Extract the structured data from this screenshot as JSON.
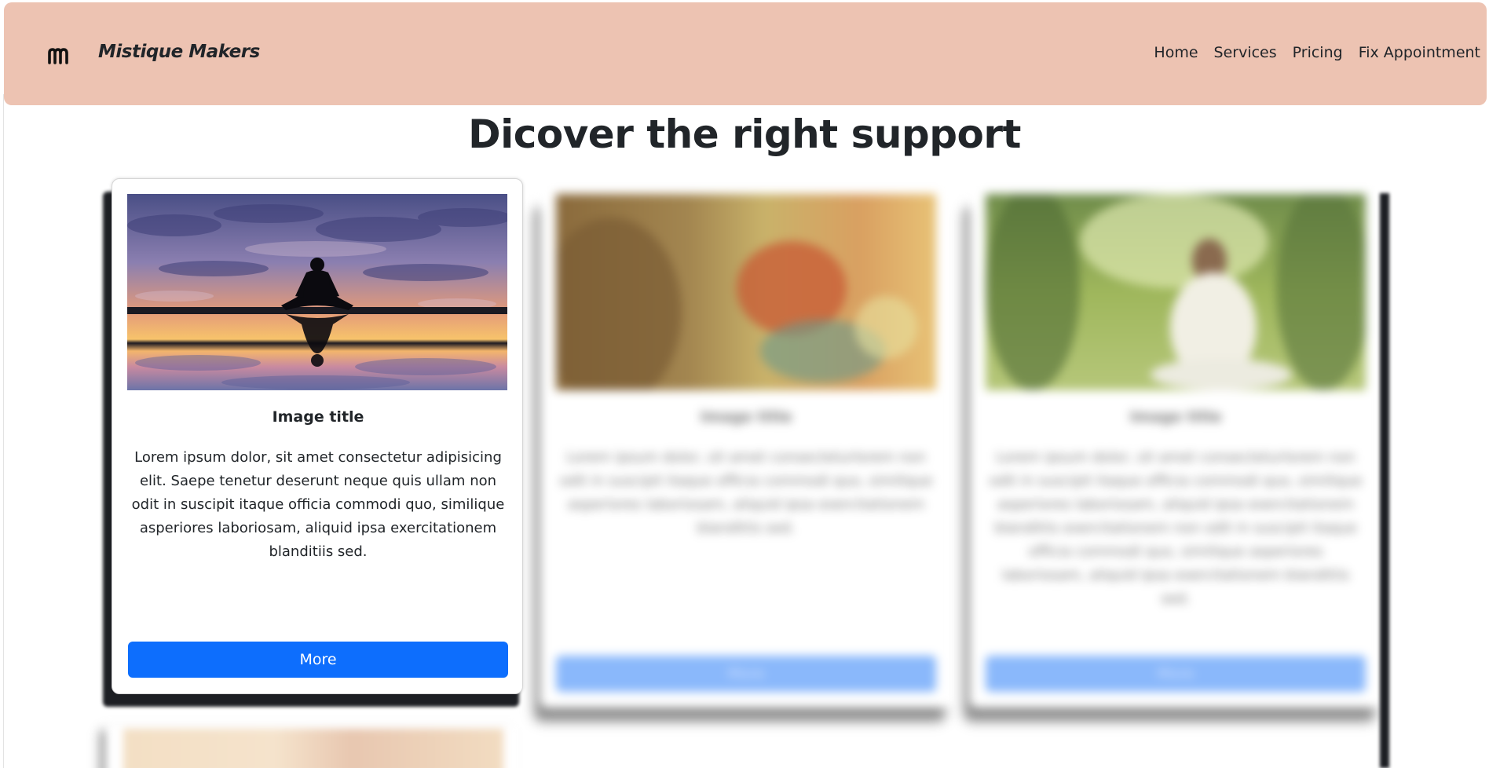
{
  "navbar": {
    "brand_name": "Mistique Makers",
    "brand_logo_icon": "m-logo-icon",
    "links": [
      "Home",
      "Services",
      "Pricing",
      "Fix Appointment"
    ],
    "background": "#edc3b2"
  },
  "main": {
    "title": "Dicover the right support"
  },
  "cards": [
    {
      "title": "Image title",
      "text": "Lorem ipsum dolor, sit amet consectetur adipisicing elit. Saepe tenetur deserunt neque quis ullam non odit in suscipit itaque officia commodi quo, similique asperiores laboriosam, aliquid ipsa exercitationem blanditiis sed.",
      "button": "More",
      "image": "meditation-sunset-image",
      "state": "focused"
    },
    {
      "title": "Image title",
      "text": "Lorem ipsum dolor, sit amet consecteturlorem non odit in suscipit itaque officia commodi quo, similique asperiores laboriosam, aliquid ipsa exercitationem blanditiis sed.",
      "button": "More",
      "image": "buddha-image",
      "state": "blurred"
    },
    {
      "title": "Image title",
      "text": "Lorem ipsum dolor, sit amet consecteturlorem non odit in suscipit itaque officia commodi quo, similique asperiores laboriosam, aliquid ipsa exercitationem blanditiis exercitationem non odit in suscipit itaque officia commodi quo, similique asperiores laboriosam, aliquid ipsa exercitationem blanditiis sed.",
      "button": "More",
      "image": "woman-meditating-image",
      "state": "blurred"
    }
  ],
  "colors": {
    "primary_button": "#0d6efd",
    "text": "#212529"
  }
}
